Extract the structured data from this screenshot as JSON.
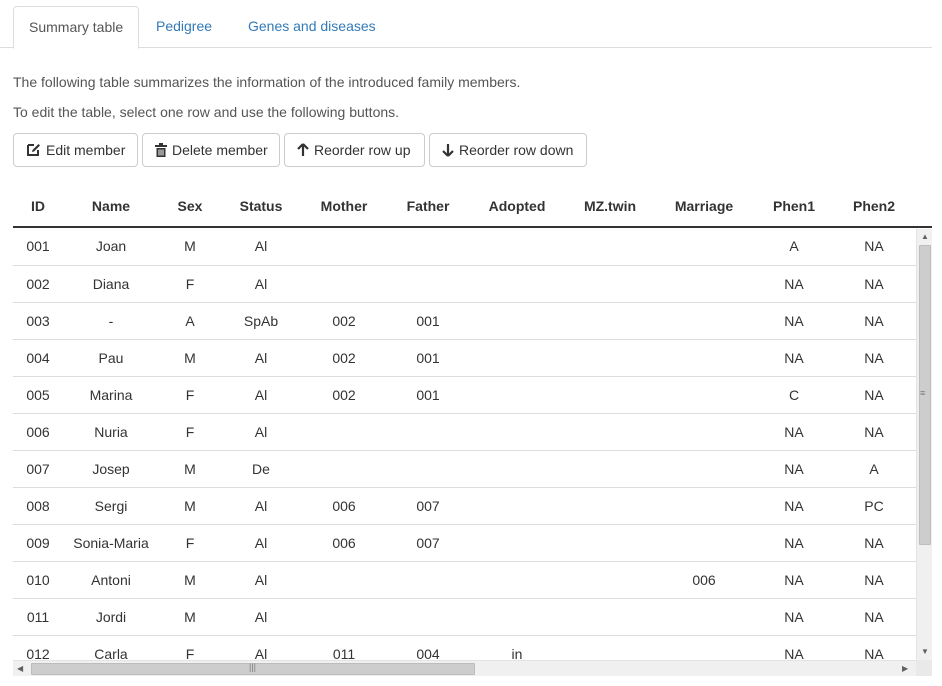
{
  "tabs": [
    {
      "label": "Summary table",
      "active": true
    },
    {
      "label": "Pedigree",
      "active": false
    },
    {
      "label": "Genes and diseases",
      "active": false
    }
  ],
  "info_lines": [
    "The following table summarizes the information of the introduced family members.",
    "To edit the table, select one row and use the following buttons."
  ],
  "buttons": {
    "edit": {
      "label": "Edit member",
      "icon": "edit-icon"
    },
    "delete": {
      "label": "Delete member",
      "icon": "trash-icon"
    },
    "up": {
      "label": "Reorder row up",
      "icon": "arrow-up-icon"
    },
    "down": {
      "label": "Reorder row down",
      "icon": "arrow-down-icon"
    }
  },
  "table": {
    "columns": [
      "ID",
      "Name",
      "Sex",
      "Status",
      "Mother",
      "Father",
      "Adopted",
      "MZ.twin",
      "Marriage",
      "Phen1",
      "Phen2"
    ],
    "rows": [
      [
        "001",
        "Joan",
        "M",
        "Al",
        "",
        "",
        "",
        "",
        "",
        "A",
        "NA"
      ],
      [
        "002",
        "Diana",
        "F",
        "Al",
        "",
        "",
        "",
        "",
        "",
        "NA",
        "NA"
      ],
      [
        "003",
        "-",
        "A",
        "SpAb",
        "002",
        "001",
        "",
        "",
        "",
        "NA",
        "NA"
      ],
      [
        "004",
        "Pau",
        "M",
        "Al",
        "002",
        "001",
        "",
        "",
        "",
        "NA",
        "NA"
      ],
      [
        "005",
        "Marina",
        "F",
        "Al",
        "002",
        "001",
        "",
        "",
        "",
        "C",
        "NA"
      ],
      [
        "006",
        "Nuria",
        "F",
        "Al",
        "",
        "",
        "",
        "",
        "",
        "NA",
        "NA"
      ],
      [
        "007",
        "Josep",
        "M",
        "De",
        "",
        "",
        "",
        "",
        "",
        "NA",
        "A"
      ],
      [
        "008",
        "Sergi",
        "M",
        "Al",
        "006",
        "007",
        "",
        "",
        "",
        "NA",
        "PC"
      ],
      [
        "009",
        "Sonia-Maria",
        "F",
        "Al",
        "006",
        "007",
        "",
        "",
        "",
        "NA",
        "NA"
      ],
      [
        "010",
        "Antoni",
        "M",
        "Al",
        "",
        "",
        "",
        "",
        "006",
        "NA",
        "NA"
      ],
      [
        "011",
        "Jordi",
        "M",
        "Al",
        "",
        "",
        "",
        "",
        "",
        "NA",
        "NA"
      ],
      [
        "012",
        "Carla",
        "F",
        "Al",
        "011",
        "004",
        "in",
        "",
        "",
        "NA",
        "NA"
      ]
    ]
  }
}
